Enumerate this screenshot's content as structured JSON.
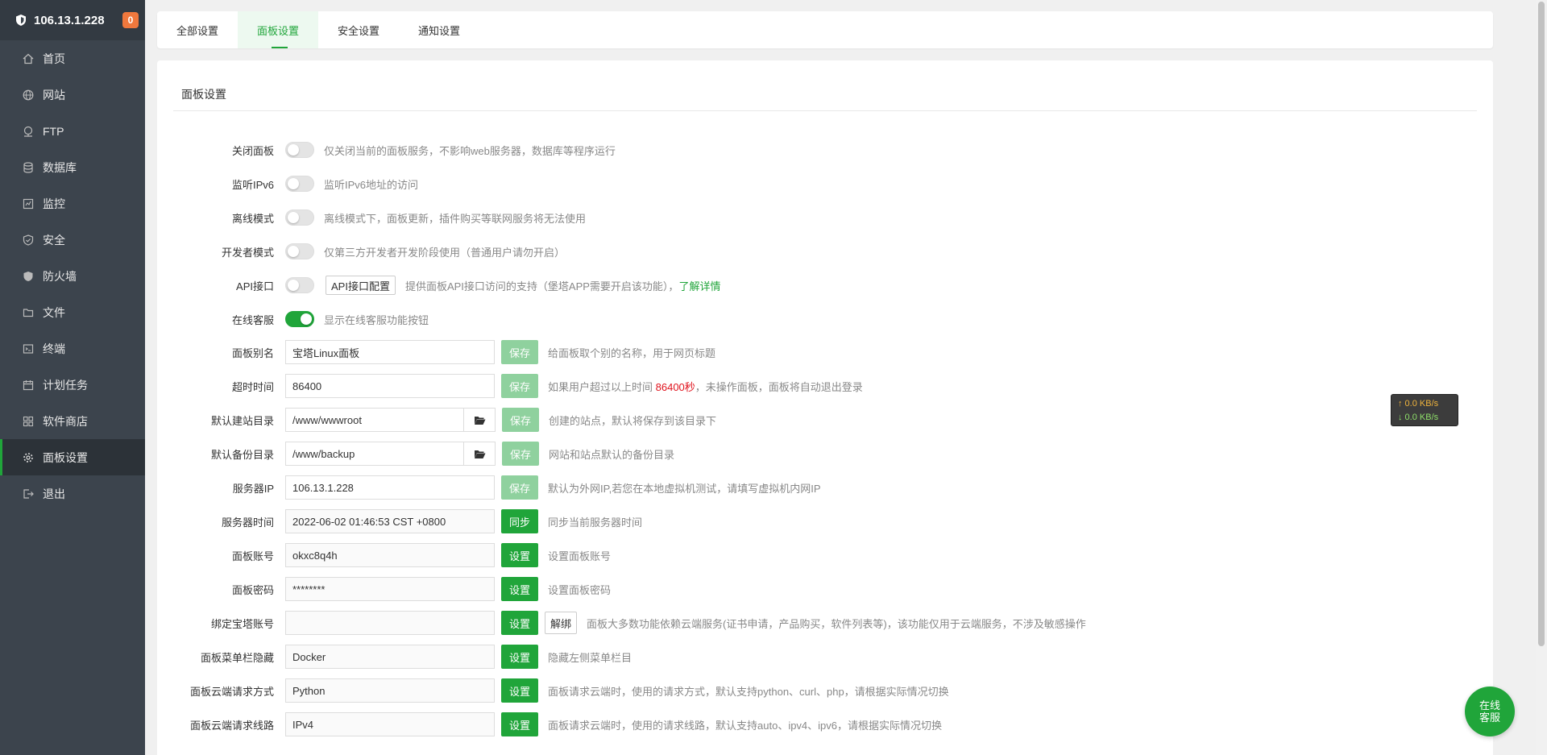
{
  "sidebar": {
    "ip": "106.13.1.228",
    "badge": "0",
    "items": [
      {
        "label": "首页",
        "icon": "home-icon"
      },
      {
        "label": "网站",
        "icon": "globe-icon"
      },
      {
        "label": "FTP",
        "icon": "ftp-icon"
      },
      {
        "label": "数据库",
        "icon": "database-icon"
      },
      {
        "label": "监控",
        "icon": "monitor-icon"
      },
      {
        "label": "安全",
        "icon": "security-icon"
      },
      {
        "label": "防火墙",
        "icon": "firewall-icon"
      },
      {
        "label": "文件",
        "icon": "folder-icon"
      },
      {
        "label": "终端",
        "icon": "terminal-icon"
      },
      {
        "label": "计划任务",
        "icon": "calendar-icon"
      },
      {
        "label": "软件商店",
        "icon": "apps-icon"
      },
      {
        "label": "面板设置",
        "icon": "gear-icon"
      },
      {
        "label": "退出",
        "icon": "logout-icon"
      }
    ]
  },
  "tabs": [
    "全部设置",
    "面板设置",
    "安全设置",
    "通知设置"
  ],
  "section_title": "面板设置",
  "toggles": [
    {
      "label": "关闭面板",
      "on": false,
      "hint": "仅关闭当前的面板服务，不影响web服务器，数据库等程序运行"
    },
    {
      "label": "监听IPv6",
      "on": false,
      "hint": "监听IPv6地址的访问"
    },
    {
      "label": "离线模式",
      "on": false,
      "hint": "离线模式下，面板更新，插件购买等联网服务将无法使用"
    },
    {
      "label": "开发者模式",
      "on": false,
      "hint": "仅第三方开发者开发阶段使用（普通用户请勿开启）"
    },
    {
      "label": "API接口",
      "on": false,
      "button": "API接口配置",
      "hint": "提供面板API接口访问的支持（堡塔APP需要开启该功能），",
      "link": "了解详情"
    },
    {
      "label": "在线客服",
      "on": true,
      "hint": "显示在线客服功能按钮"
    }
  ],
  "fields": [
    {
      "label": "面板别名",
      "value": "宝塔Linux面板",
      "button": "保存",
      "hint": "给面板取个别的名称，用于网页标题"
    },
    {
      "label": "超时时间",
      "value": "86400",
      "button": "保存",
      "hint_pre": "如果用户超过以上时间 ",
      "hint_red": "86400秒",
      "hint_post": "，未操作面板，面板将自动退出登录"
    },
    {
      "label": "默认建站目录",
      "value": "/www/wwwroot",
      "button": "保存",
      "hint": "创建的站点，默认将保存到该目录下"
    },
    {
      "label": "默认备份目录",
      "value": "/www/backup",
      "button": "保存",
      "hint": "网站和站点默认的备份目录"
    },
    {
      "label": "服务器IP",
      "value": "106.13.1.228",
      "button": "保存",
      "hint": "默认为外网IP,若您在本地虚拟机测试，请填写虚拟机内网IP"
    },
    {
      "label": "服务器时间",
      "value": "2022-06-02 01:46:53 CST +0800",
      "button": "同步",
      "hint": "同步当前服务器时间"
    },
    {
      "label": "面板账号",
      "value": "okxc8q4h",
      "button": "设置",
      "hint": "设置面板账号"
    },
    {
      "label": "面板密码",
      "value": "********",
      "button": "设置",
      "hint": "设置面板密码"
    },
    {
      "label": "绑定宝塔账号",
      "value": "",
      "button": "设置",
      "extra_button": "解绑",
      "hint": "面板大多数功能依赖云端服务(证书申请，产品购买，软件列表等)，该功能仅用于云端服务，不涉及敏感操作"
    },
    {
      "label": "面板菜单栏隐藏",
      "value": "Docker",
      "button": "设置",
      "hint": "隐藏左侧菜单栏目"
    },
    {
      "label": "面板云端请求方式",
      "value": "Python",
      "button": "设置",
      "hint": "面板请求云端时，使用的请求方式，默认支持python、curl、php，请根据实际情况切换"
    },
    {
      "label": "面板云端请求线路",
      "value": "IPv4",
      "button": "设置",
      "hint": "面板请求云端时，使用的请求线路，默认支持auto、ipv4、ipv6，请根据实际情况切换"
    }
  ],
  "netspeed": {
    "up": "↑ 0.0 KB/s",
    "down": "↓ 0.0 KB/s"
  },
  "float_button": {
    "line1": "在线",
    "line2": "客服"
  },
  "colors": {
    "accent": "#20a53a",
    "sidebar": "#3c444d",
    "red": "#e0121c"
  }
}
